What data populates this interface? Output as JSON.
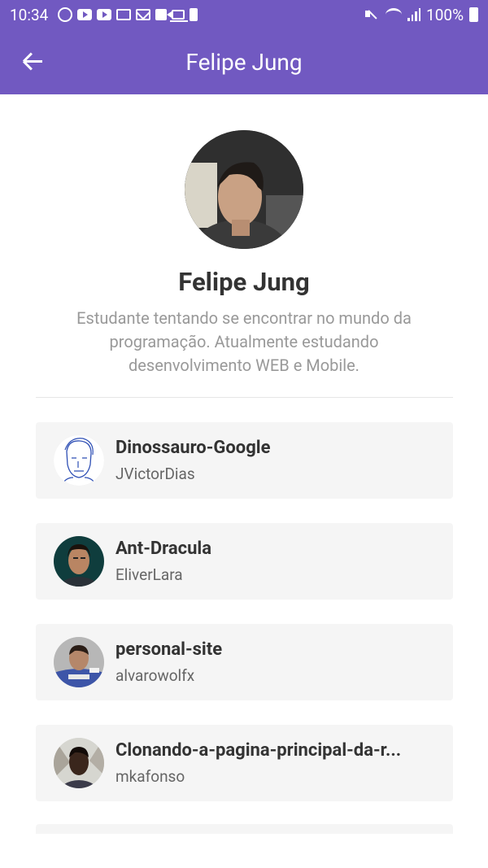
{
  "status_bar": {
    "time": "10:34",
    "battery": "100%",
    "left_icons": [
      "whatsapp-icon",
      "youtube-icon",
      "youtube-icon",
      "voicemail-icon",
      "mail-icon",
      "video-camera-icon",
      "laptop-icon",
      "battery-saver-icon"
    ],
    "right_icons": [
      "mute-icon",
      "wifi-icon",
      "signal-icon",
      "battery-icon"
    ]
  },
  "app_bar": {
    "title": "Felipe Jung",
    "back_icon": "arrow-left-icon",
    "color": "#7159c1"
  },
  "profile": {
    "name": "Felipe Jung",
    "bio": "Estudante tentando se encontrar no mundo da programação. Atualmente estudando desenvolvimento WEB e Mobile."
  },
  "repos": [
    {
      "title": "Dinossauro-Google",
      "owner": "JVictorDias"
    },
    {
      "title": "Ant-Dracula",
      "owner": "EliverLara"
    },
    {
      "title": "personal-site",
      "owner": "alvarowolfx"
    },
    {
      "title": "Clonando-a-pagina-principal-da-r...",
      "owner": "mkafonso"
    }
  ],
  "colors": {
    "primary": "#7159c1",
    "card_bg": "#f5f5f5",
    "title_text": "#333333",
    "bio_text": "#999999",
    "owner_text": "#666666"
  }
}
